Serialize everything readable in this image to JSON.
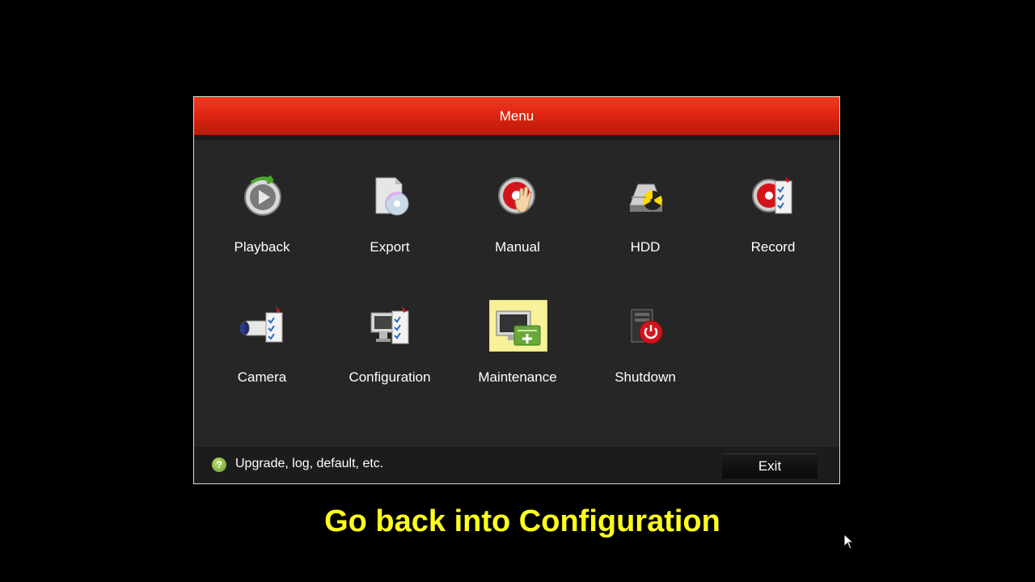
{
  "window": {
    "title": "Menu"
  },
  "tiles": [
    {
      "label": "Playback",
      "icon": "playback-icon"
    },
    {
      "label": "Export",
      "icon": "export-icon"
    },
    {
      "label": "Manual",
      "icon": "manual-icon"
    },
    {
      "label": "HDD",
      "icon": "hdd-icon"
    },
    {
      "label": "Record",
      "icon": "record-icon"
    },
    {
      "label": "Camera",
      "icon": "camera-icon"
    },
    {
      "label": "Configuration",
      "icon": "configuration-icon"
    },
    {
      "label": "Maintenance",
      "icon": "maintenance-icon",
      "selected": true
    },
    {
      "label": "Shutdown",
      "icon": "shutdown-icon"
    }
  ],
  "status": {
    "text": "Upgrade, log, default, etc.",
    "help_icon": "?"
  },
  "exit_label": "Exit",
  "caption": "Go back into Configuration",
  "colors": {
    "title_bar": "#e02613",
    "selection": "#f7f199",
    "caption": "#ffff1e"
  }
}
